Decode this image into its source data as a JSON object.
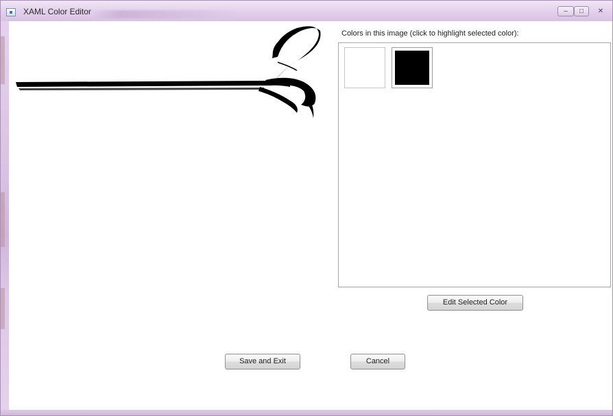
{
  "window": {
    "title": "XAML Color Editor",
    "icon": "app-window-icon",
    "controls": {
      "minimize_icon": "minimize-icon",
      "maximize_icon": "maximize-icon",
      "close_icon": "close-icon"
    }
  },
  "palette": {
    "label": "Colors in this image (click to highlight selected color):",
    "colors": [
      {
        "hex": "#ffffff",
        "name": "white"
      },
      {
        "hex": "#000000",
        "name": "black"
      }
    ]
  },
  "preview": {
    "image": "calligraphic-swash-ornament",
    "colors": {
      "stroke": "#000000",
      "background": "#ffffff"
    }
  },
  "buttons": {
    "edit_selected": "Edit Selected Color",
    "save_and_exit": "Save and Exit",
    "cancel": "Cancel"
  }
}
